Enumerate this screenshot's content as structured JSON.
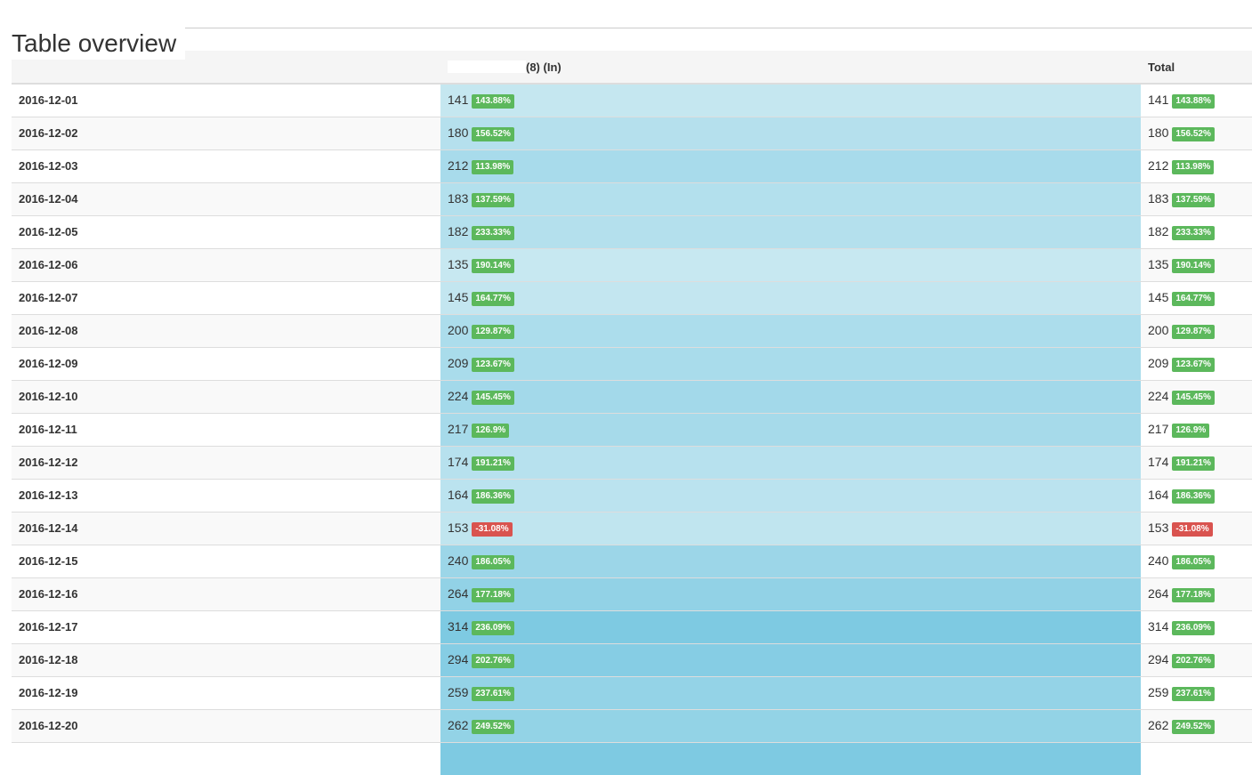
{
  "page": {
    "title": "Table overview"
  },
  "table": {
    "headers": {
      "date": "",
      "in": "(8) (In)",
      "total": "Total"
    },
    "colors": {
      "positive": "#5cb85c",
      "negative": "#d9534f",
      "heat_low": "#c7e8f1",
      "heat_high": "#7ecae2"
    },
    "rows": [
      {
        "date": "2016-12-01",
        "in": "141",
        "in_badge": "143.88%",
        "total": "141",
        "total_badge": "143.88%",
        "negative": false
      },
      {
        "date": "2016-12-02",
        "in": "180",
        "in_badge": "156.52%",
        "total": "180",
        "total_badge": "156.52%",
        "negative": false
      },
      {
        "date": "2016-12-03",
        "in": "212",
        "in_badge": "113.98%",
        "total": "212",
        "total_badge": "113.98%",
        "negative": false
      },
      {
        "date": "2016-12-04",
        "in": "183",
        "in_badge": "137.59%",
        "total": "183",
        "total_badge": "137.59%",
        "negative": false
      },
      {
        "date": "2016-12-05",
        "in": "182",
        "in_badge": "233.33%",
        "total": "182",
        "total_badge": "233.33%",
        "negative": false
      },
      {
        "date": "2016-12-06",
        "in": "135",
        "in_badge": "190.14%",
        "total": "135",
        "total_badge": "190.14%",
        "negative": false
      },
      {
        "date": "2016-12-07",
        "in": "145",
        "in_badge": "164.77%",
        "total": "145",
        "total_badge": "164.77%",
        "negative": false
      },
      {
        "date": "2016-12-08",
        "in": "200",
        "in_badge": "129.87%",
        "total": "200",
        "total_badge": "129.87%",
        "negative": false
      },
      {
        "date": "2016-12-09",
        "in": "209",
        "in_badge": "123.67%",
        "total": "209",
        "total_badge": "123.67%",
        "negative": false
      },
      {
        "date": "2016-12-10",
        "in": "224",
        "in_badge": "145.45%",
        "total": "224",
        "total_badge": "145.45%",
        "negative": false
      },
      {
        "date": "2016-12-11",
        "in": "217",
        "in_badge": "126.9%",
        "total": "217",
        "total_badge": "126.9%",
        "negative": false
      },
      {
        "date": "2016-12-12",
        "in": "174",
        "in_badge": "191.21%",
        "total": "174",
        "total_badge": "191.21%",
        "negative": false
      },
      {
        "date": "2016-12-13",
        "in": "164",
        "in_badge": "186.36%",
        "total": "164",
        "total_badge": "186.36%",
        "negative": false
      },
      {
        "date": "2016-12-14",
        "in": "153",
        "in_badge": "-31.08%",
        "total": "153",
        "total_badge": "-31.08%",
        "negative": true
      },
      {
        "date": "2016-12-15",
        "in": "240",
        "in_badge": "186.05%",
        "total": "240",
        "total_badge": "186.05%",
        "negative": false
      },
      {
        "date": "2016-12-16",
        "in": "264",
        "in_badge": "177.18%",
        "total": "264",
        "total_badge": "177.18%",
        "negative": false
      },
      {
        "date": "2016-12-17",
        "in": "314",
        "in_badge": "236.09%",
        "total": "314",
        "total_badge": "236.09%",
        "negative": false
      },
      {
        "date": "2016-12-18",
        "in": "294",
        "in_badge": "202.76%",
        "total": "294",
        "total_badge": "202.76%",
        "negative": false
      },
      {
        "date": "2016-12-19",
        "in": "259",
        "in_badge": "237.61%",
        "total": "259",
        "total_badge": "237.61%",
        "negative": false
      },
      {
        "date": "2016-12-20",
        "in": "262",
        "in_badge": "249.52%",
        "total": "262",
        "total_badge": "249.52%",
        "negative": false
      }
    ]
  }
}
